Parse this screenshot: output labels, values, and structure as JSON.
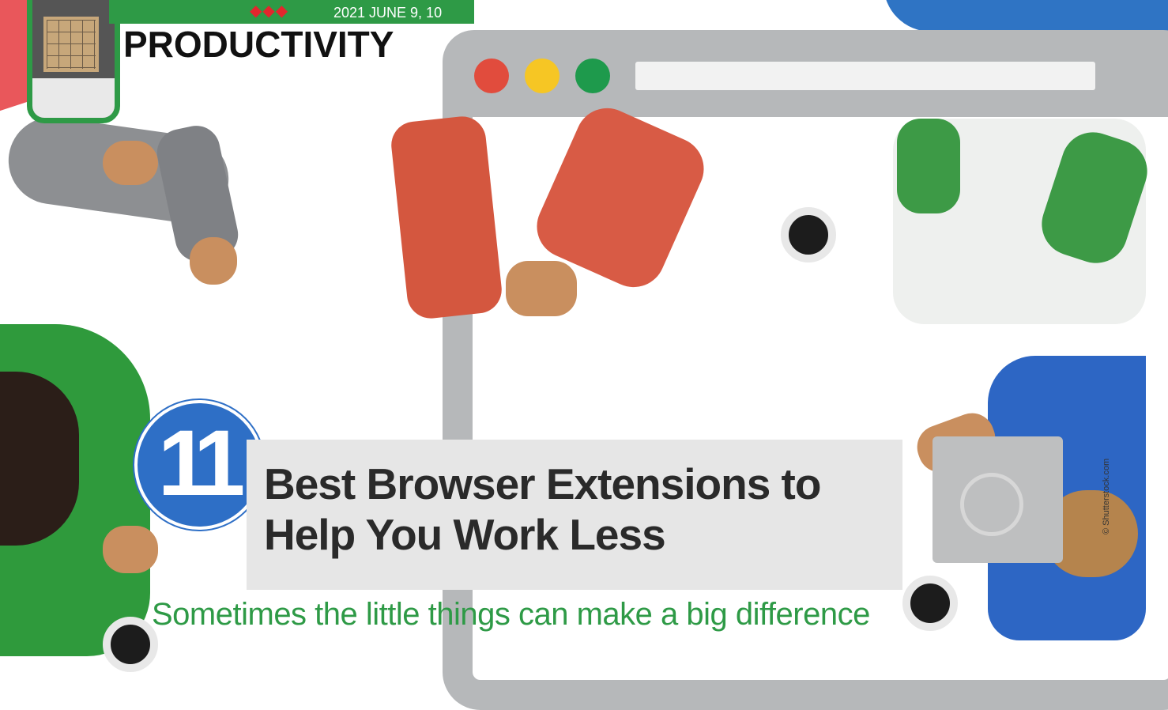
{
  "header": {
    "decoration": "◆◆◆",
    "date": "2021 JUNE 9, 10",
    "category": "PRODUCTIVITY"
  },
  "article": {
    "number": "11",
    "title_line1": "Best Browser Extensions to",
    "title_line2": "Help You Work Less",
    "subtitle": "Sometimes the little things can make a big difference"
  },
  "credit": "© Shutterstock.com",
  "colors": {
    "brand_green": "#2e9a46",
    "accent_blue": "#2e6fc6",
    "accent_red": "#e3262d",
    "browser_grey": "#b6b8ba"
  }
}
